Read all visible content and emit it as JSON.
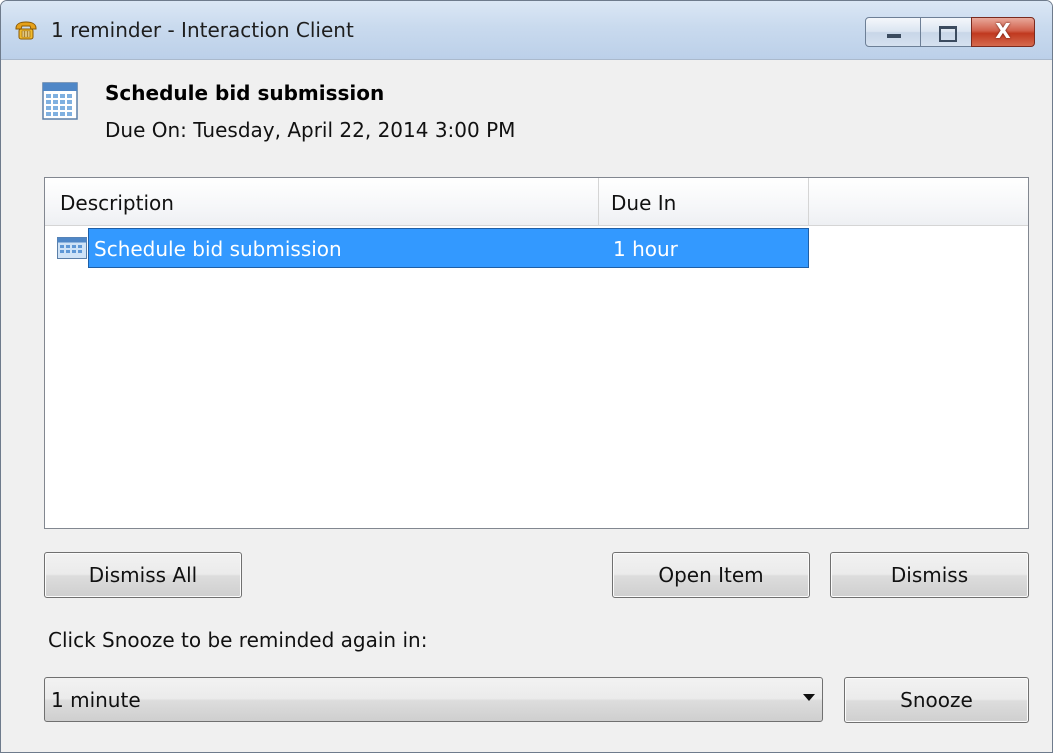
{
  "window": {
    "title": "1 reminder - Interaction Client",
    "controls": {
      "minimize_icon": "minimize-icon",
      "maximize_icon": "maximize-icon",
      "close_icon": "close-icon",
      "close_glyph": "X"
    },
    "app_icon": "telephone-icon"
  },
  "header": {
    "icon": "calendar-icon",
    "title": "Schedule bid submission",
    "due_on": "Due On: Tuesday, April 22, 2014 3:00 PM"
  },
  "list": {
    "columns": [
      "Description",
      "Due In"
    ],
    "rows": [
      {
        "icon": "calendar-icon",
        "description": "Schedule bid submission",
        "due_in": "1 hour",
        "selected": true
      }
    ]
  },
  "actions": {
    "dismiss_all": "Dismiss All",
    "open_item": "Open Item",
    "dismiss": "Dismiss"
  },
  "snooze": {
    "prompt": "Click Snooze to be reminded again in:",
    "selected_interval": "1 minute",
    "button": "Snooze"
  },
  "colors": {
    "selection": "#3399ff",
    "close_button": "#c0391f",
    "titlebar": "#c9daee"
  }
}
